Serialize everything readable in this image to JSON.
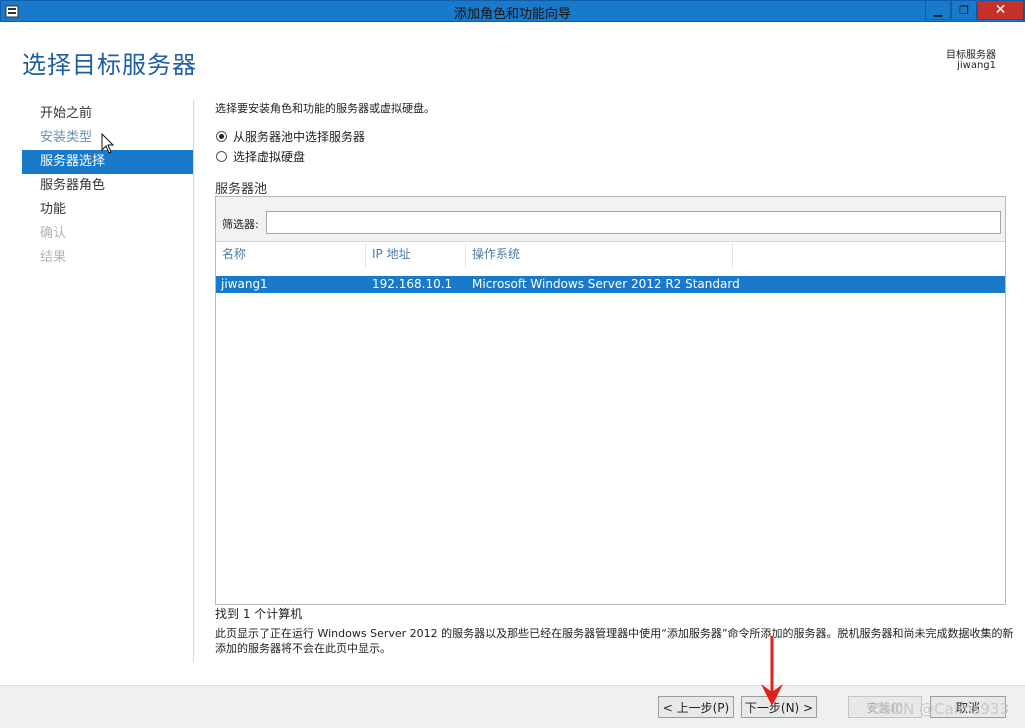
{
  "window": {
    "title": "添加角色和功能向导"
  },
  "header": {
    "page_title": "选择目标服务器",
    "target_label": "目标服务器",
    "target_name": "jiwang1"
  },
  "nav": {
    "items": [
      {
        "label": "开始之前"
      },
      {
        "label": "安装类型"
      },
      {
        "label": "服务器选择"
      },
      {
        "label": "服务器角色"
      },
      {
        "label": "功能"
      },
      {
        "label": "确认"
      },
      {
        "label": "结果"
      }
    ]
  },
  "main": {
    "instruction": "选择要安装角色和功能的服务器或虚拟硬盘。",
    "radio_pool": "从服务器池中选择服务器",
    "radio_vhd": "选择虚拟硬盘",
    "pool_label": "服务器池",
    "filter_label": "筛选器:",
    "filter_value": "",
    "columns": {
      "name": "名称",
      "ip": "IP 地址",
      "os": "操作系统"
    },
    "rows": [
      {
        "name": "jiwang1",
        "ip": "192.168.10.1",
        "os": "Microsoft Windows Server 2012 R2 Standard"
      }
    ],
    "found": "找到 1 个计算机",
    "description": "此页显示了正在运行 Windows Server 2012 的服务器以及那些已经在服务器管理器中使用“添加服务器”命令所添加的服务器。脱机服务器和尚未完成数据收集的新添加的服务器将不会在此页中显示。"
  },
  "footer": {
    "prev": "< 上一步(P)",
    "next": "下一步(N) >",
    "install": "安装(I)",
    "cancel": "取消"
  },
  "watermark": "CSDN @Calms933",
  "colors": {
    "accent": "#1979ca",
    "selected_row": "#1979ca",
    "annotation_arrow": "#e0201b"
  }
}
